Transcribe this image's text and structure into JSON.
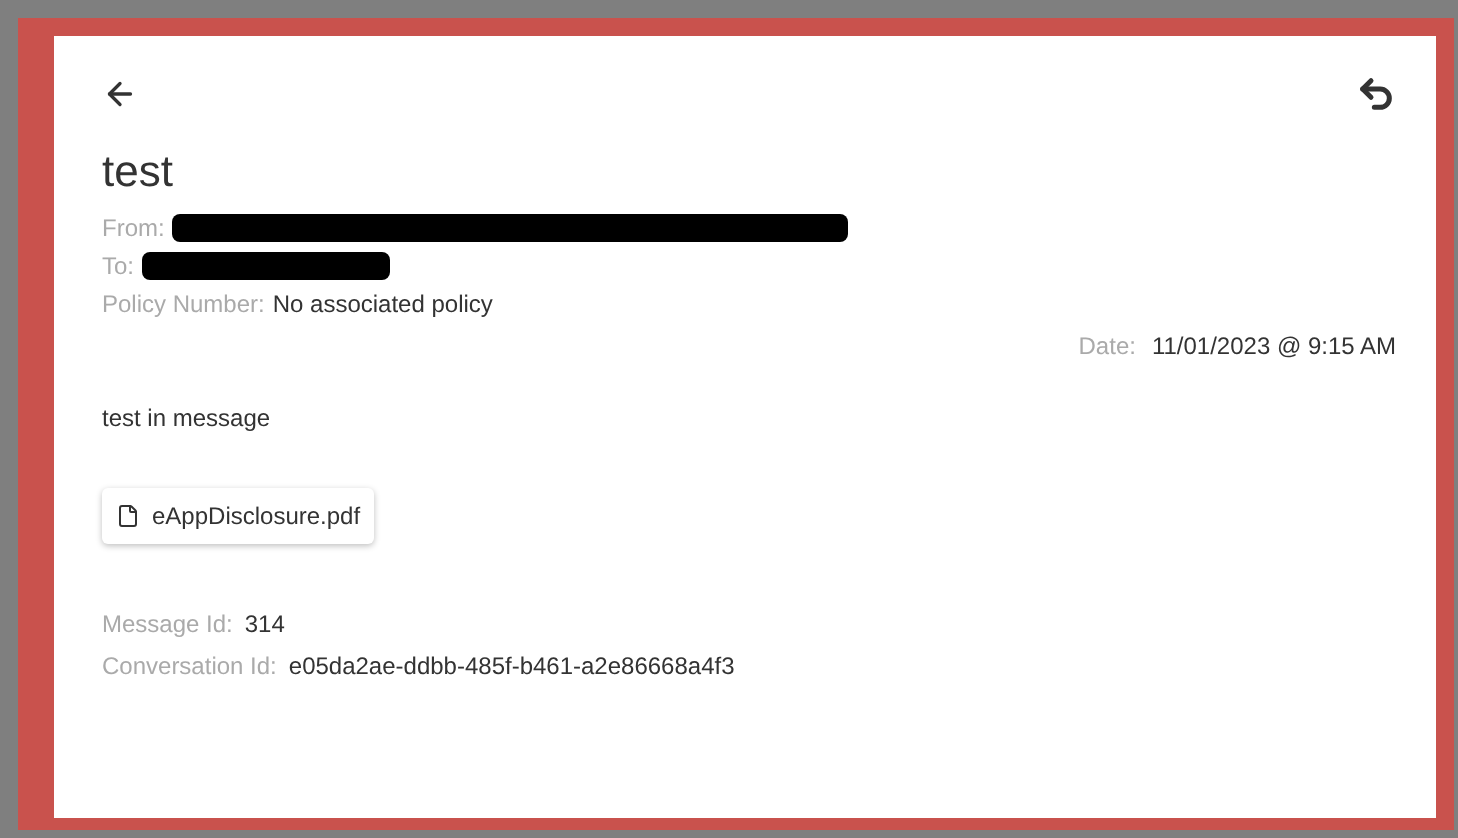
{
  "subject": "test",
  "header_fields": [
    {
      "label": "From:",
      "redacted": true
    },
    {
      "label": "To:",
      "redacted": true
    },
    {
      "label": "Policy Number:",
      "value": "No associated policy",
      "redacted": false
    }
  ],
  "date": {
    "label": "Date:",
    "value": "11/01/2023 @ 9:15 AM"
  },
  "body": "test in message",
  "attachments": [
    {
      "name": "eAppDisclosure.pdf"
    }
  ],
  "footer_fields": [
    {
      "label": "Message Id:",
      "value": "314"
    },
    {
      "label": "Conversation Id:",
      "value": "e05da2ae-ddbb-485f-b461-a2e86668a4f3"
    }
  ]
}
